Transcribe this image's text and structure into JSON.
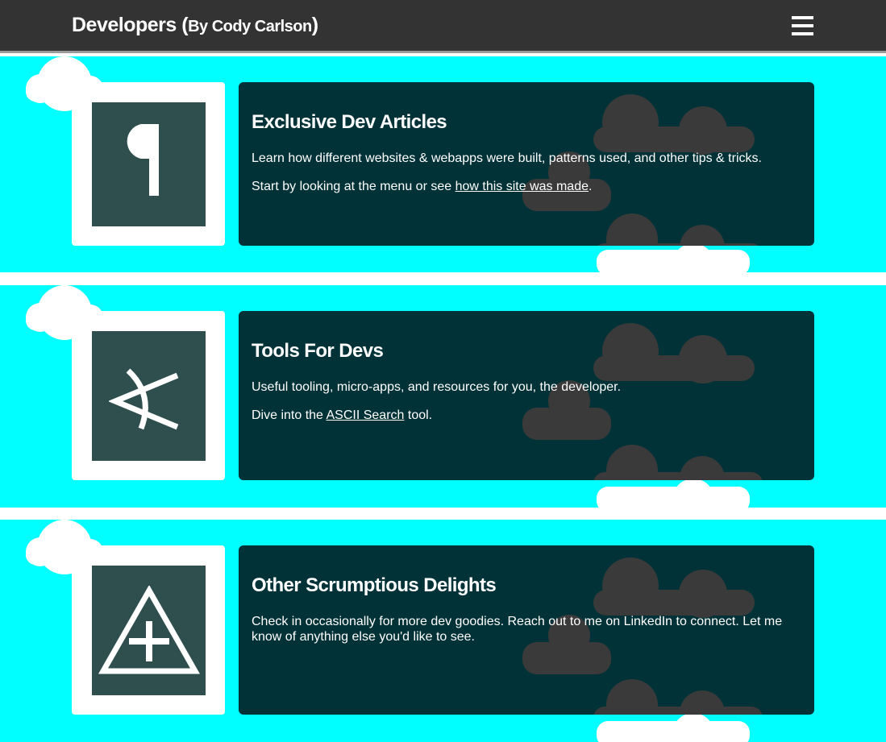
{
  "header": {
    "title": "Developers",
    "paren_open": "(",
    "byline": "By Cody Carlson",
    "paren_close": ")",
    "menu_icon": "hamburger-menu-icon"
  },
  "colors": {
    "header_bg": "#333333",
    "section_bg": "#00ffff",
    "card_bg": "#003237",
    "tile_bg": "#2f4f4f",
    "cloud_dark": "#333333",
    "cloud_light": "#ffffff"
  },
  "sections": [
    {
      "icon": "pilcrow-icon",
      "icon_glyph": "¶",
      "title": "Exclusive Dev Articles",
      "line1": "Learn how different websites & webapps were built, patterns used, and other tips & tricks.",
      "line2_pre": "Start by looking at the menu or see ",
      "line2_link": "how this site was made",
      "line2_post": "."
    },
    {
      "icon": "ascii-symbol-icon",
      "title": "Tools For Devs",
      "line1": "Useful tooling, micro-apps, and resources for you, the developer.",
      "line2_pre": "Dive into the ",
      "line2_link": "ASCII Search",
      "line2_post": " tool."
    },
    {
      "icon": "triangle-plus-icon",
      "title": "Other Scrumptious Delights",
      "line1": "Check in occasionally for more dev goodies. Reach out to me on LinkedIn to connect. Let me know of anything else you'd like to see."
    }
  ]
}
